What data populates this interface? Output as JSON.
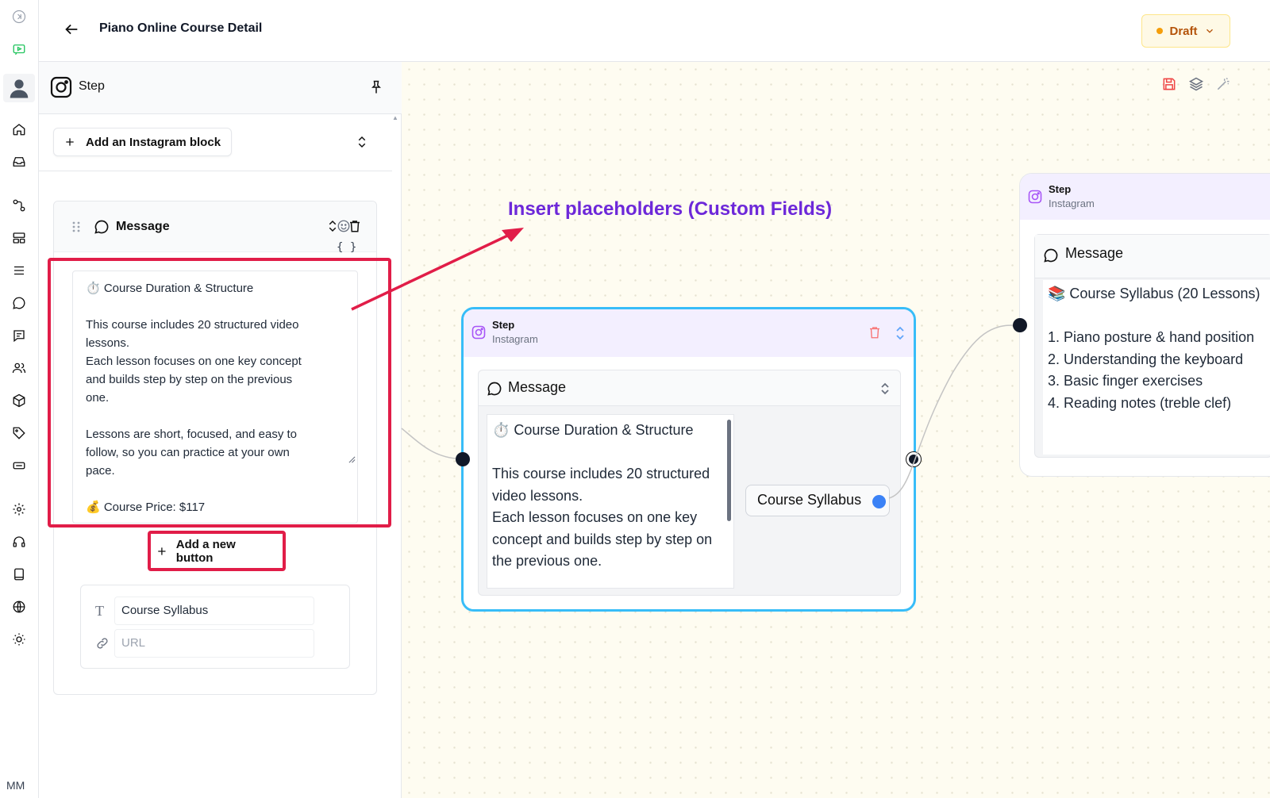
{
  "header": {
    "title": "Piano Online Course Detail",
    "status": "Draft"
  },
  "rail": {
    "user_initials": "MM"
  },
  "panel": {
    "title": "Step",
    "add_block_label": "Add an Instagram block",
    "message_label": "Message",
    "message_lines": [
      "⏱️ Course Duration & Structure",
      "",
      "This course includes 20 structured video lessons.",
      "Each lesson focuses on one key concept and builds step by step on the previous one.",
      "",
      "Lessons are short, focused, and easy to follow, so you can practice at your own pace.",
      "",
      "💰 Course Price: $117"
    ],
    "placeholder_icon": "{ }",
    "add_button_label": "Add a new button",
    "button_text_value": "Course Syllabus",
    "button_url_placeholder": "URL"
  },
  "annotation": {
    "text": "Insert placeholders (Custom Fields)",
    "color": "#6d28d9",
    "arrow_color": "#e11d48"
  },
  "nodes": [
    {
      "title": "Step",
      "subtitle": "Instagram",
      "message_label": "Message",
      "lines": [
        "⏱️ Course Duration & Structure",
        "",
        "This course includes 20 structured video lessons.",
        "Each lesson focuses on one key concept and builds step by step on the previous one."
      ],
      "button_label": "Course Syllabus"
    },
    {
      "title": "Step",
      "subtitle": "Instagram",
      "message_label": "Message",
      "lines": [
        "📚 Course Syllabus (20 Lessons)",
        "",
        "1. Piano posture & hand position",
        "2. Understanding the keyboard",
        "3. Basic finger exercises",
        "4. Reading notes (treble clef)"
      ]
    }
  ],
  "colors": {
    "accent": "#38bdf8",
    "draft_bg": "#fef9e6",
    "draft_text": "#b45309",
    "annotation_red": "#e11d48"
  },
  "icons": {
    "rail": [
      "collapse-icon",
      "chatbot-icon",
      "avatar",
      "home-icon",
      "inbox-icon",
      "workflow-icon",
      "layout-icon",
      "list-icon",
      "chat-icon",
      "message-square-icon",
      "users-icon",
      "package-icon",
      "tag-icon",
      "ticket-icon",
      "settings-icon",
      "headset-icon",
      "book-icon",
      "globe-icon",
      "sun-icon"
    ],
    "canvas_tools": [
      "save-icon",
      "layers-icon",
      "magic-icon"
    ]
  }
}
